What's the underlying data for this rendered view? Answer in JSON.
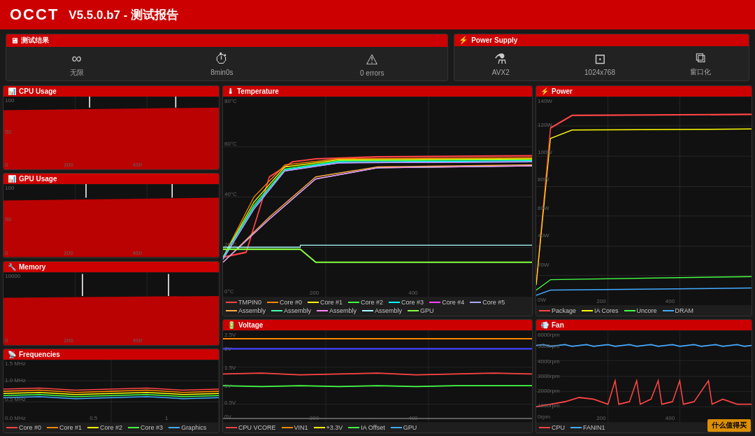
{
  "header": {
    "logo": "OCCT",
    "title": "V5.5.0.b7 - 测试报告"
  },
  "summary_left": {
    "title": "测试结果",
    "items": [
      {
        "icon": "∞",
        "label": "无限",
        "name": "infinity"
      },
      {
        "icon": "⏱",
        "label": "8min0s",
        "name": "timer"
      },
      {
        "icon": "⚠",
        "label": "0 errors",
        "name": "errors"
      }
    ]
  },
  "summary_right": {
    "title": "Power Supply",
    "items": [
      {
        "icon": "⚗",
        "label": "AVX2",
        "name": "avx2"
      },
      {
        "icon": "⊡",
        "label": "1024x768",
        "name": "resolution"
      },
      {
        "icon": "⧉",
        "label": "窗口化",
        "name": "windowed"
      }
    ]
  },
  "panels": {
    "cpu_usage": {
      "title": "CPU Usage",
      "y_max": "100",
      "y_mid": "50",
      "y_min": "0",
      "x_marks": [
        "200",
        "400"
      ]
    },
    "gpu_usage": {
      "title": "GPU Usage",
      "y_max": "100",
      "y_mid": "50",
      "y_min": "0",
      "x_marks": [
        "200",
        "400"
      ]
    },
    "memory": {
      "title": "Memory",
      "y_max": "10000",
      "y_min": "0",
      "x_marks": [
        "200",
        "400"
      ]
    },
    "frequencies": {
      "title": "Frequencies",
      "y_labels": [
        "1.5 MHz",
        "1.0 MHz",
        "0.5 MHz",
        "0.0 MHz"
      ],
      "x_marks": [
        "0.5",
        "1"
      ],
      "legend": [
        {
          "label": "Core #0",
          "color": "#ff4444"
        },
        {
          "label": "Core #1",
          "color": "#ff8800"
        },
        {
          "label": "Core #2",
          "color": "#ffff00"
        },
        {
          "label": "Core #3",
          "color": "#44ff44"
        },
        {
          "label": "Graphics",
          "color": "#44aaff"
        }
      ]
    },
    "temperature": {
      "title": "Temperature",
      "y_labels": [
        "80°C",
        "60°C",
        "40°C",
        "20°C",
        "0°C"
      ],
      "x_marks": [
        "200",
        "400"
      ],
      "legend": [
        {
          "label": "TMPIN0",
          "color": "#ff4444"
        },
        {
          "label": "Core #0",
          "color": "#ff8800"
        },
        {
          "label": "Core #1",
          "color": "#ffff00"
        },
        {
          "label": "Core #2",
          "color": "#44ff44"
        },
        {
          "label": "Core #3",
          "color": "#00ffff"
        },
        {
          "label": "Core #4",
          "color": "#ff44ff"
        },
        {
          "label": "Core #5",
          "color": "#aaaaff"
        },
        {
          "label": "Assembly",
          "color": "#ffaa44"
        },
        {
          "label": "Assembly",
          "color": "#44ffaa"
        },
        {
          "label": "Assembly",
          "color": "#ff88ff"
        },
        {
          "label": "Assembly",
          "color": "#aaffff"
        },
        {
          "label": "GPU",
          "color": "#88ff44"
        }
      ]
    },
    "voltage": {
      "title": "Voltage",
      "y_labels": [
        "2.5V",
        "2V",
        "1.5V",
        "1V",
        "0.5V",
        "0V"
      ],
      "x_marks": [
        "200",
        "400"
      ],
      "legend": [
        {
          "label": "CPU VCORE",
          "color": "#ff4444"
        },
        {
          "label": "VIN1",
          "color": "#ff8800"
        },
        {
          "label": "+3.3V",
          "color": "#ffff00"
        },
        {
          "label": "IA Offset",
          "color": "#44ff44"
        },
        {
          "label": "GPU",
          "color": "#44aaff"
        }
      ]
    },
    "power": {
      "title": "Power",
      "y_labels": [
        "140W",
        "120W",
        "100W",
        "80W",
        "60W",
        "40W",
        "20W",
        "0W"
      ],
      "x_marks": [
        "200",
        "400"
      ],
      "legend": [
        {
          "label": "Package",
          "color": "#ff4444"
        },
        {
          "label": "IA Cores",
          "color": "#ffff00"
        },
        {
          "label": "Uncore",
          "color": "#44ff44"
        },
        {
          "label": "DRAM",
          "color": "#44aaff"
        }
      ]
    },
    "fan": {
      "title": "Fan",
      "y_labels": [
        "6000rpm",
        "5000rpm",
        "4000rpm",
        "3000rpm",
        "2000rpm",
        "1000rpm",
        "0rpm"
      ],
      "x_marks": [
        "200",
        "400"
      ],
      "legend": [
        {
          "label": "CPU",
          "color": "#ff4444"
        },
        {
          "label": "FANIN1",
          "color": "#44aaff"
        }
      ]
    }
  },
  "watermark": "什么值得买"
}
